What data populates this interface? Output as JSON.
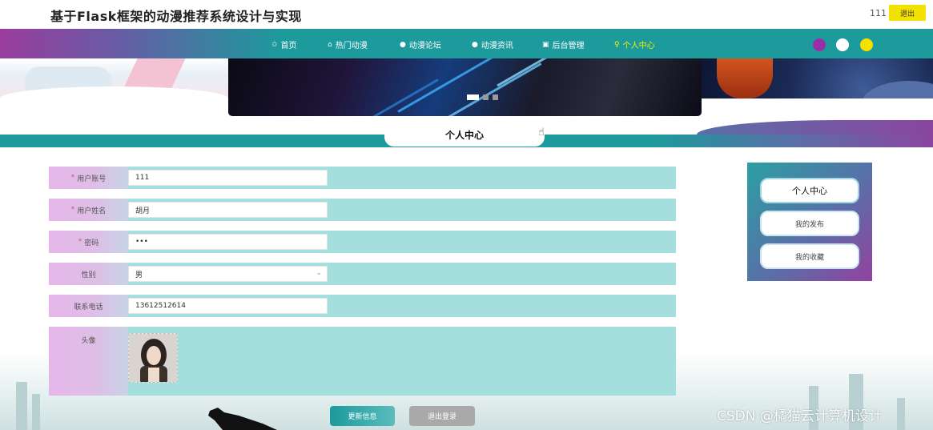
{
  "header": {
    "site_title": "基于Flask框架的动漫推荐系统设计与实现",
    "username": "111",
    "logout_label": "退出"
  },
  "nav": {
    "items": [
      {
        "icon": "star-icon",
        "glyph": "✩",
        "label": "首页"
      },
      {
        "icon": "home-icon",
        "glyph": "⌂",
        "label": "热门动漫"
      },
      {
        "icon": "forum-icon",
        "glyph": "●",
        "label": "动漫论坛"
      },
      {
        "icon": "news-icon",
        "glyph": "●",
        "label": "动漫资讯"
      },
      {
        "icon": "admin-icon",
        "glyph": "▣",
        "label": "后台管理"
      },
      {
        "icon": "user-icon",
        "glyph": "♀",
        "label": "个人中心"
      }
    ],
    "active_index": 5,
    "theme_colors": [
      "#9b2fa6",
      "#ffffff",
      "#f6e000"
    ]
  },
  "banner": {
    "slide_count": 3,
    "active_slide": 1
  },
  "section": {
    "title": "个人中心"
  },
  "form": {
    "fields": [
      {
        "label": "用户账号",
        "required": true,
        "value": "111"
      },
      {
        "label": "用户姓名",
        "required": true,
        "value": "胡月"
      },
      {
        "label": "密码",
        "required": true,
        "value": "•••"
      },
      {
        "label": "性别",
        "required": false,
        "value": "男"
      },
      {
        "label": "联系电话",
        "required": false,
        "value": "13612512614"
      }
    ],
    "avatar_label": "头像",
    "update_button": "更新信息",
    "logout_button": "退出登录"
  },
  "sidebar": {
    "items": [
      "个人中心",
      "我的发布",
      "我的收藏"
    ],
    "active_index": 0
  },
  "watermark": "CSDN @橘猫云计算机设计",
  "colors": {
    "teal": "#1c9a9c",
    "purple": "#9242a0",
    "form_row": "#a4dedd",
    "nav_active": "#f8f000"
  }
}
